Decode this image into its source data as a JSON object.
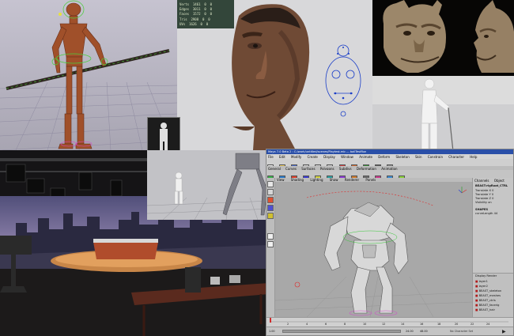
{
  "face_stats": {
    "rows": [
      {
        "label": "Verts",
        "v1": "1461",
        "v2": "0",
        "v3": "0"
      },
      {
        "label": "Edges",
        "v1": "3011",
        "v2": "0",
        "v3": "0"
      },
      {
        "label": "Faces",
        "v1": "1572",
        "v2": "0",
        "v3": "0"
      },
      {
        "label": "Tris",
        "v1": "2908",
        "v2": "0",
        "v3": "0"
      },
      {
        "label": "UVs",
        "v1": "1626",
        "v2": "0",
        "v3": "0"
      }
    ]
  },
  "maya": {
    "title": "Maya 7.0 Beta 2 : C:/work/untitled/scenes/Playtest.mb --- ballTestRun",
    "menu": [
      "File",
      "Edit",
      "Modify",
      "Create",
      "Display",
      "Window",
      "Animate",
      "Deform",
      "Skeleton",
      "Skin",
      "Constrain",
      "Character",
      "Help"
    ],
    "shelf_tabs": [
      "General",
      "Curves",
      "Surfaces",
      "Polygons",
      "Subdivs",
      "Deformation",
      "Animation"
    ],
    "viewport_menu": [
      "View",
      "Shading",
      "Lighting",
      "Show",
      "Renderer",
      "Panels"
    ],
    "channel_box": {
      "tabs": [
        "Channels",
        "Object"
      ],
      "node": "BEAST:rigRoot_CTRL",
      "attributes": [
        {
          "name": "Translate X",
          "value": "0"
        },
        {
          "name": "Translate Y",
          "value": "0"
        },
        {
          "name": "Translate Z",
          "value": "0"
        },
        {
          "name": "Visibility",
          "value": "on"
        }
      ],
      "section": "SHAPES",
      "shape_attr": {
        "name": "curveLength",
        "value": "44"
      }
    },
    "layer_editor": {
      "options": [
        "Display",
        "Render"
      ],
      "layers": [
        "layer1",
        "layer2",
        "BEAST_skeleton",
        "BEAST_meshes",
        "BEAST_ctrls",
        "BEAST_facerig",
        "BEAST_hair"
      ]
    },
    "timeline": {
      "start": "1.00",
      "end": "24.00",
      "range_end": "48.00",
      "ticks": [
        "2",
        "4",
        "6",
        "8",
        "10",
        "12",
        "14",
        "16",
        "18",
        "20",
        "22",
        "24"
      ]
    },
    "status": "No Character Set"
  },
  "colors": {
    "maya_bg": "#c8c8c8",
    "viewport_bg": "#aaaaaa",
    "stage_floor": "#1e1c1c"
  }
}
